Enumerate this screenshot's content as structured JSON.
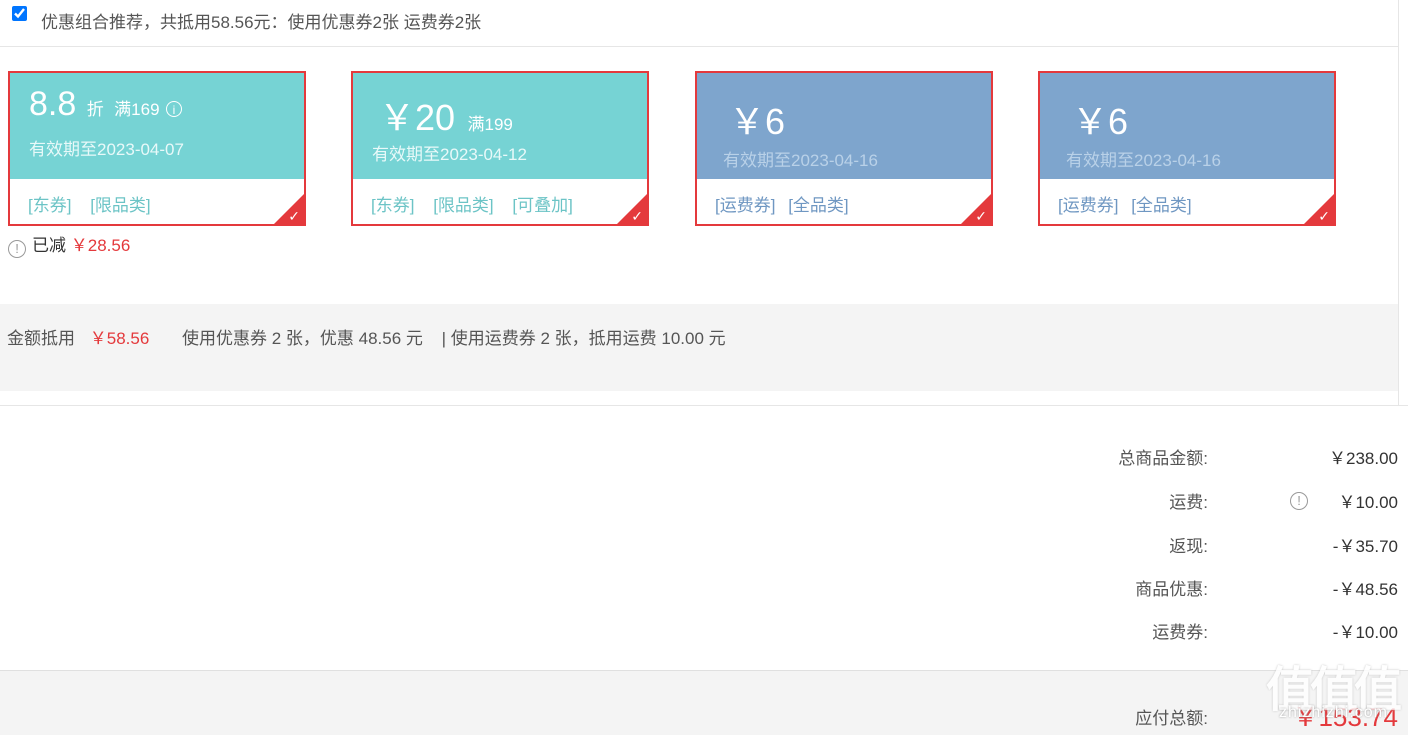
{
  "recommendation": {
    "checked": true,
    "text": "优惠组合推荐，共抵用58.56元：使用优惠券2张 运费券2张"
  },
  "coupons": [
    {
      "amount": "8.8",
      "unit": "折",
      "condition": "满169",
      "valid": "有效期至2023-04-07",
      "tags": [
        "[东券]",
        "[限品类]"
      ],
      "selected": true,
      "color": "#76d3d4"
    },
    {
      "amount": "￥20",
      "condition": "满199",
      "valid": "有效期至2023-04-12",
      "tags": [
        "[东券]",
        "[限品类]",
        "[可叠加]"
      ],
      "selected": true,
      "color": "#76d3d4"
    },
    {
      "amount": "￥6",
      "valid": "有效期至2023-04-16",
      "tags": [
        "[运费券]",
        "[全品类]"
      ],
      "selected": true,
      "color": "#7ea5cd"
    },
    {
      "amount": "￥6",
      "valid": "有效期至2023-04-16",
      "tags": [
        "[运费券]",
        "[全品类]"
      ],
      "selected": true,
      "color": "#7ea5cd"
    }
  ],
  "reduced": {
    "label": "已减",
    "value": "￥28.56"
  },
  "summary": {
    "label": "金额抵用",
    "amount": "￥58.56",
    "coupon_text": "使用优惠券 2 张，优惠 48.56 元",
    "shipping_text": "| 使用运费券 2 张，抵用运费 10.00 元"
  },
  "totals": {
    "goods_label": "总商品金额:",
    "goods_value": "￥238.00",
    "shipping_label": "运费:",
    "shipping_value": "￥10.00",
    "cashback_label": "返现:",
    "cashback_value": "-￥35.70",
    "discount_label": "商品优惠:",
    "discount_value": "-￥48.56",
    "ship_coupon_label": "运费券:",
    "ship_coupon_value": "-￥10.00",
    "pay_label": "应付总额:",
    "pay_value": "￥153.74"
  },
  "watermark": {
    "main": "值值值",
    "sub": "zhizhizhi.com"
  },
  "colors": {
    "accent_red": "#e4393c",
    "teal": "#76d3d4",
    "blue": "#7ea5cd",
    "orange": "#f56600"
  }
}
